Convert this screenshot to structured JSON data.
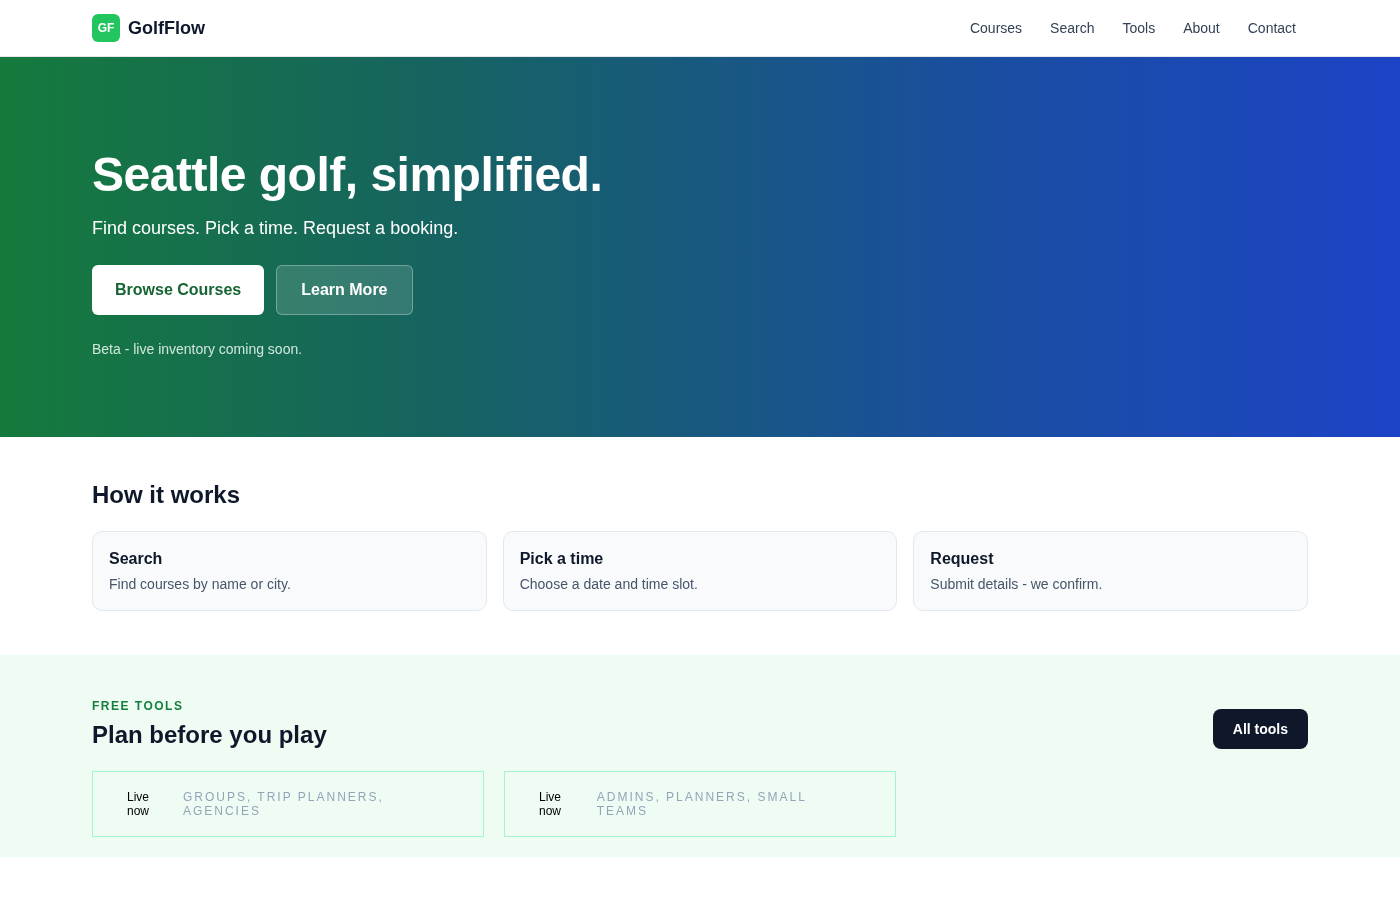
{
  "brand": {
    "logo": "GF",
    "name": "GolfFlow"
  },
  "nav": [
    "Courses",
    "Search",
    "Tools",
    "About",
    "Contact"
  ],
  "hero": {
    "title": "Seattle golf, simplified.",
    "subtitle": "Find courses. Pick a time. Request a booking.",
    "primary_button": "Browse Courses",
    "secondary_button": "Learn More",
    "note": "Beta - live inventory coming soon."
  },
  "how_it_works": {
    "heading": "How it works",
    "steps": [
      {
        "title": "Search",
        "text": "Find courses by name or city."
      },
      {
        "title": "Pick a time",
        "text": "Choose a date and time slot."
      },
      {
        "title": "Request",
        "text": "Submit details - we confirm."
      }
    ]
  },
  "tools": {
    "eyebrow": "FREE TOOLS",
    "heading": "Plan before you play",
    "button": "All tools",
    "cards": [
      {
        "status": "Live now",
        "audience": "GROUPS, TRIP PLANNERS, AGENCIES"
      },
      {
        "status": "Live now",
        "audience": "ADMINS, PLANNERS, SMALL TEAMS"
      }
    ]
  }
}
